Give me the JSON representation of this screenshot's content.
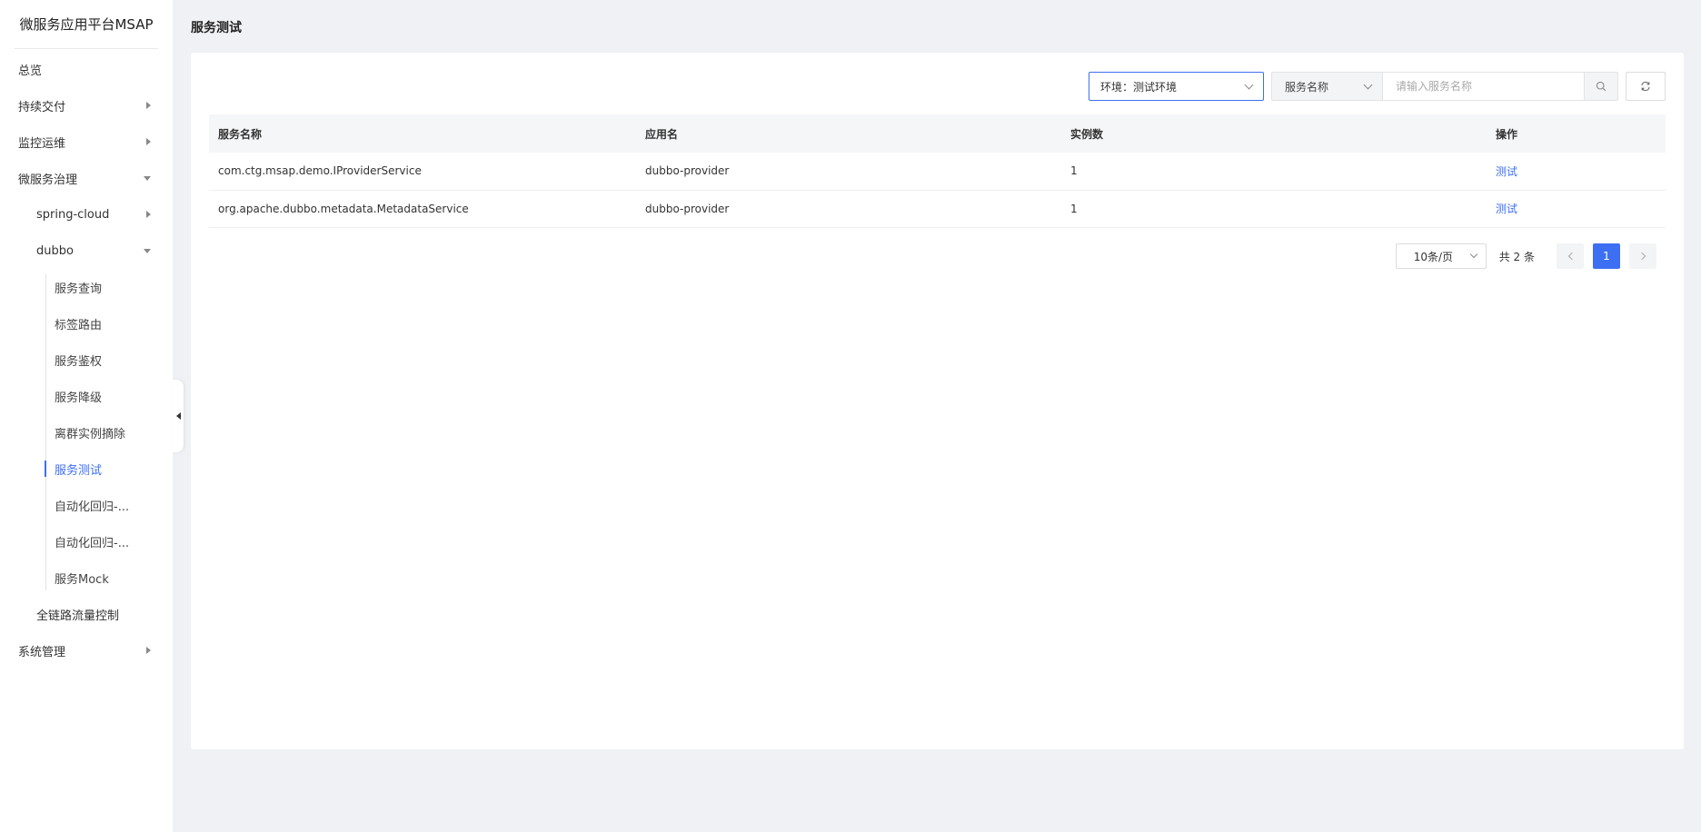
{
  "sidebar": {
    "logo": "微服务应用平台MSAP",
    "items": [
      {
        "label": "总览"
      },
      {
        "label": "持续交付"
      },
      {
        "label": "监控运维"
      },
      {
        "label": "微服务治理"
      },
      {
        "label": "spring-cloud"
      },
      {
        "label": "dubbo"
      },
      {
        "label": "服务查询"
      },
      {
        "label": "标签路由"
      },
      {
        "label": "服务鉴权"
      },
      {
        "label": "服务降级"
      },
      {
        "label": "离群实例摘除"
      },
      {
        "label": "服务测试"
      },
      {
        "label": "自动化回归-..."
      },
      {
        "label": "自动化回归-..."
      },
      {
        "label": "服务Mock"
      },
      {
        "label": "全链路流量控制"
      },
      {
        "label": "系统管理"
      }
    ]
  },
  "page": {
    "title": "服务测试"
  },
  "toolbar": {
    "env_select": "环境：测试环境",
    "field_select": "服务名称",
    "search_placeholder": "请输入服务名称"
  },
  "table": {
    "headers": [
      "服务名称",
      "应用名",
      "实例数",
      "操作"
    ],
    "rows": [
      {
        "service": "com.ctg.msap.demo.IProviderService",
        "app": "dubbo-provider",
        "instances": "1",
        "action": "测试"
      },
      {
        "service": "org.apache.dubbo.metadata.MetadataService",
        "app": "dubbo-provider",
        "instances": "1",
        "action": "测试"
      }
    ]
  },
  "pagination": {
    "page_size": "10条/页",
    "total": "共 2 条",
    "current": "1"
  },
  "colors": {
    "accent": "#3d6ff2",
    "background": "#f0f1f4"
  }
}
